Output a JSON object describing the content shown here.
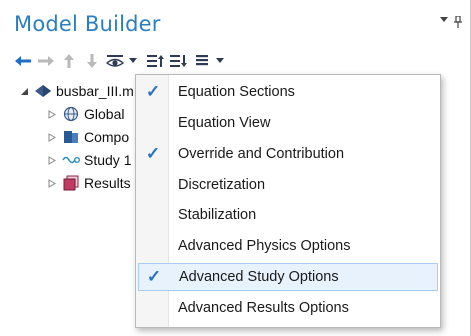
{
  "panel": {
    "title": "Model Builder"
  },
  "tree": {
    "items": [
      {
        "label": "busbar_III.m",
        "icon": "component-diamond-icon"
      },
      {
        "label": "Global",
        "icon": "globe-icon"
      },
      {
        "label": "Compo",
        "icon": "folder-icon"
      },
      {
        "label": "Study 1",
        "icon": "study-icon"
      },
      {
        "label": "Results",
        "icon": "results-icon"
      }
    ]
  },
  "menu": {
    "items": [
      {
        "label": "Equation Sections",
        "checked": true
      },
      {
        "label": "Equation View",
        "checked": false
      },
      {
        "label": "Override and Contribution",
        "checked": true
      },
      {
        "label": "Discretization",
        "checked": false
      },
      {
        "label": "Stabilization",
        "checked": false
      },
      {
        "label": "Advanced Physics Options",
        "checked": false
      },
      {
        "label": "Advanced Study Options",
        "checked": true,
        "highlighted": true
      },
      {
        "label": "Advanced Results Options",
        "checked": false
      }
    ],
    "check_glyph": "✓"
  },
  "colors": {
    "title": "#2a7fc1",
    "arrow_active": "#1f6fc5",
    "arrow_disabled": "#b9b9b9",
    "check": "#2b73c4",
    "highlight_bg": "#e8f2fc",
    "highlight_border": "#a9cdee"
  }
}
